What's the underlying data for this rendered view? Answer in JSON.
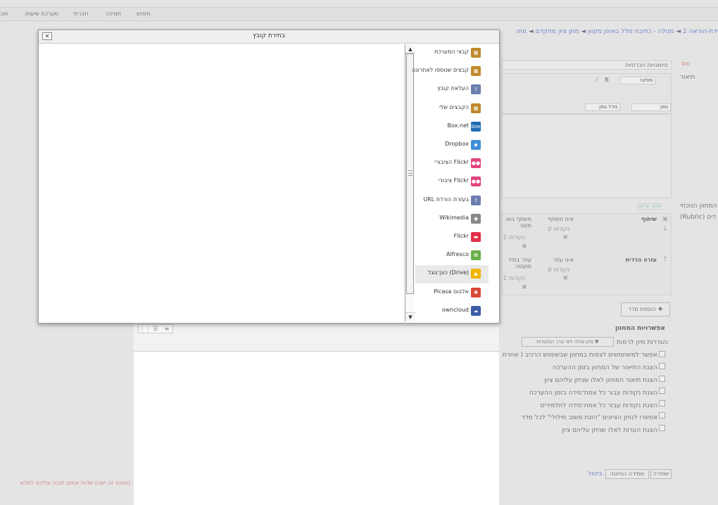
{
  "top_nav": [
    "תוכ",
    "מערכת שיעות",
    "חברתי",
    "תמיכה",
    "חיפוש"
  ],
  "breadcrumb": [
    "מתן ציון מתקדם",
    "מטלה - כתיבת מלל באופן מקוון",
    "ידת-הוראה 2"
  ],
  "breadcrumb_cut": "מחו",
  "form": {
    "name_label": "שם",
    "name_value": "מיומנויות חברתיות",
    "desc_label": "תיאור",
    "paragraph_select": "פסקה",
    "font_select": "גופן",
    "size_select": "גודל גופן",
    "path_label": "נתיב: עריכה",
    "current_rubric_label": "המחוון הנוכחי",
    "rubric_label": "(Rubric) דים",
    "add_criterion_button": "הוספת מדד",
    "criteria": [
      {
        "name": "שיתוף",
        "levels": [
          {
            "definition": "אינו משתף",
            "points": "0 נקודות"
          },
          {
            "definition": "משתף באו מעט",
            "points": "1 נקודות"
          }
        ]
      },
      {
        "name": "עזרה הדדית",
        "levels": [
          {
            "definition": "אינו עוזר",
            "points": "0 נקודות"
          },
          {
            "definition": "עוזר במיד מועטה",
            "points": "1 נקודות"
          }
        ]
      }
    ]
  },
  "options": {
    "heading": "אפשרויות המחוון",
    "sort_label": "הגדרות מיון לרמות:",
    "sort_value": "מיון עולה לפי ערך הנקודות ▼",
    "checkboxes": [
      "אפשר למשתמשים לצפות במחוון שבשימוש הרכיב ( אחרת",
      "הצגת התיאור של המחוון בזמן ההערכה",
      "הצגת תיאור המחוון לאלו שניתן עליהם ציון",
      "הצגת נקודות עבור כל אמת־מידה בזמן ההערכה",
      "הצגת נקודות עבור כל אמת־מידה לתלמידים",
      "אפשרו לנותן הציונים \"הזנת משוב מילולי\" לכל מדד",
      "הצגת הערות לאלו שניתן עליהם ציון"
    ]
  },
  "buttons": {
    "save": "שמירה",
    "save_draft": "שמירה כטיוטה",
    "cancel": "ביטול"
  },
  "status_text": "בטופס זה ישנם שדות אותם חובה עליכם למלא",
  "dialog": {
    "title": "בחירת קובץ",
    "close": "✕",
    "repositories": [
      {
        "label": "קבצי המערכת",
        "icon": "server-files-icon",
        "color": "#c08a2c"
      },
      {
        "label": "קבצים שנוספו לאחרונה",
        "icon": "recent-files-icon",
        "color": "#c08a2c"
      },
      {
        "label": "העלאת קובץ",
        "icon": "upload-file-icon",
        "color": "#6a7fae"
      },
      {
        "label": "הקבצים שלי",
        "icon": "private-files-icon",
        "color": "#c08a2c"
      },
      {
        "label": "Box.net",
        "icon": "boxnet-icon",
        "color": "#1f6fb5"
      },
      {
        "label": "Dropbox",
        "icon": "dropbox-icon",
        "color": "#3d8fd6"
      },
      {
        "label": "Flickr הציבורי",
        "icon": "flickr-public-icon",
        "color": "#e2437f"
      },
      {
        "label": "Flickr ציבורי",
        "icon": "flickr-icon",
        "color": "#e2437f"
      },
      {
        "label": "בעזרת הורדת URL",
        "icon": "url-download-icon",
        "color": "#6a7fae"
      },
      {
        "label": "Wikimedia",
        "icon": "wikimedia-icon",
        "color": "#888888"
      },
      {
        "label": "Flickr",
        "icon": "flickr-red-icon",
        "color": "#e0304a"
      },
      {
        "label": "Alfresco",
        "icon": "alfresco-icon",
        "color": "#6ab04c"
      },
      {
        "label": "(Drive) כונן־גוגל",
        "icon": "google-drive-icon",
        "color": "#f2b400"
      },
      {
        "label": "אלבום Picasa",
        "icon": "picasa-icon",
        "color": "#d84a38"
      },
      {
        "label": "owncloud",
        "icon": "owncloud-icon",
        "color": "#3b5ea8"
      }
    ],
    "active_repository_index": 12
  },
  "file_view_buttons": [
    "⋮⋮",
    "☰",
    "≡"
  ]
}
